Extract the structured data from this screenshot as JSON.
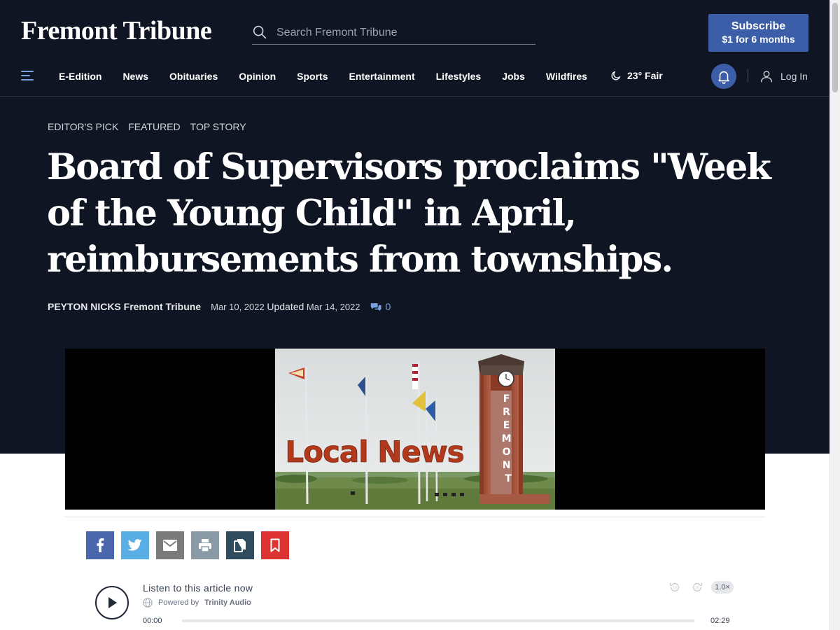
{
  "brand": {
    "logo": "Fremont Tribune"
  },
  "search": {
    "placeholder": "Search Fremont Tribune"
  },
  "subscribe": {
    "line1": "Subscribe",
    "line2": "$1 for 6 months"
  },
  "nav": {
    "items": [
      "E-Edition",
      "News",
      "Obituaries",
      "Opinion",
      "Sports",
      "Entertainment",
      "Lifestyles",
      "Jobs",
      "Wildfires"
    ],
    "weather": "23° Fair",
    "login": "Log In"
  },
  "article": {
    "tags": [
      "EDITOR'S PICK",
      "FEATURED",
      "TOP STORY"
    ],
    "headline": "Board of Supervisors proclaims \"Week of the Young Child\" in April, reimbursements from townships.",
    "author": "PEYTON NICKS Fremont Tribune",
    "published": "Mar 10, 2022",
    "updated_label": "Updated",
    "updated": "Mar 14, 2022",
    "comment_count": "0",
    "image_overlay_text": "Local News",
    "clock_tower_text": "FREMONT"
  },
  "share": {
    "buttons": [
      {
        "name": "facebook",
        "color": "#4a67ad"
      },
      {
        "name": "twitter",
        "color": "#5aaee6"
      },
      {
        "name": "email",
        "color": "#7b7b7b"
      },
      {
        "name": "print",
        "color": "#8a9aa4"
      },
      {
        "name": "copy",
        "color": "#2f4c5e"
      },
      {
        "name": "bookmark",
        "color": "#dd3333"
      }
    ]
  },
  "audio": {
    "listen_label": "Listen to this article now",
    "powered_prefix": "Powered by",
    "powered_brand": "Trinity Audio",
    "speed": "1.0×",
    "time_current": "00:00",
    "time_total": "02:29",
    "progress": 0,
    "skip_back": "10",
    "skip_forward": "10"
  },
  "colors": {
    "background": "#0f1522",
    "accent": "#3c5ea8",
    "link": "#7aa2e0"
  }
}
